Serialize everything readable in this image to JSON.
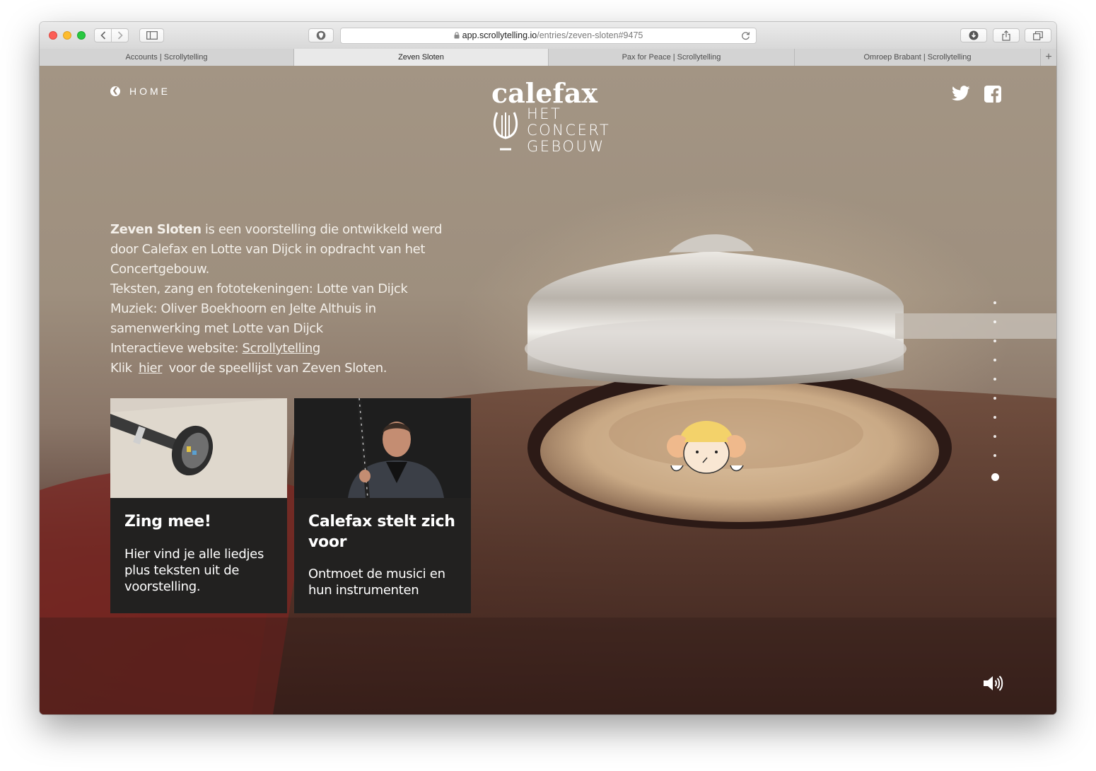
{
  "browser": {
    "url_host": "app.scrollytelling.io",
    "url_path": "/entries/zeven-sloten#9475",
    "tabs": [
      {
        "label": "Accounts | Scrollytelling",
        "active": false
      },
      {
        "label": "Zeven Sloten",
        "active": true
      },
      {
        "label": "Pax for Peace | Scrollytelling",
        "active": false
      },
      {
        "label": "Omroep Brabant | Scrollytelling",
        "active": false
      }
    ],
    "new_tab_label": "+"
  },
  "header": {
    "home_label": "HOME",
    "logo": {
      "brand": "calefax",
      "line1": "HET",
      "line2": "CONCERT",
      "line3": "GEBOUW"
    },
    "social_icons": [
      "twitter-icon",
      "facebook-icon"
    ]
  },
  "intro": {
    "title_bold": "Zeven Sloten",
    "p1_rest": " is een voorstelling die ontwikkeld werd door Calefax en Lotte van Dijck in opdracht van het Concertgebouw.",
    "line2": "Teksten, zang en fototekeningen: Lotte van Dijck",
    "line3": "Muziek: Oliver Boekhoorn en Jelte Althuis in samenwerking met Lotte van Dijck",
    "line4_prefix": "Interactieve website: ",
    "line4_link": "Scrollytelling",
    "line5_prefix": "Klik ",
    "line5_link": "hier",
    "line5_suffix": " voor de speellijst van Zeven Sloten."
  },
  "cards": [
    {
      "title": "Zing mee!",
      "description": "Hier vind je alle liedjes plus teksten uit de voorstelling."
    },
    {
      "title": "Calefax stelt zich voor",
      "description": "Ontmoet de musici en hun instrumenten"
    }
  ],
  "navigation": {
    "section_count": 10,
    "active_section": 10
  },
  "colors": {
    "card_bg": "#222120",
    "text": "#ffffff"
  }
}
